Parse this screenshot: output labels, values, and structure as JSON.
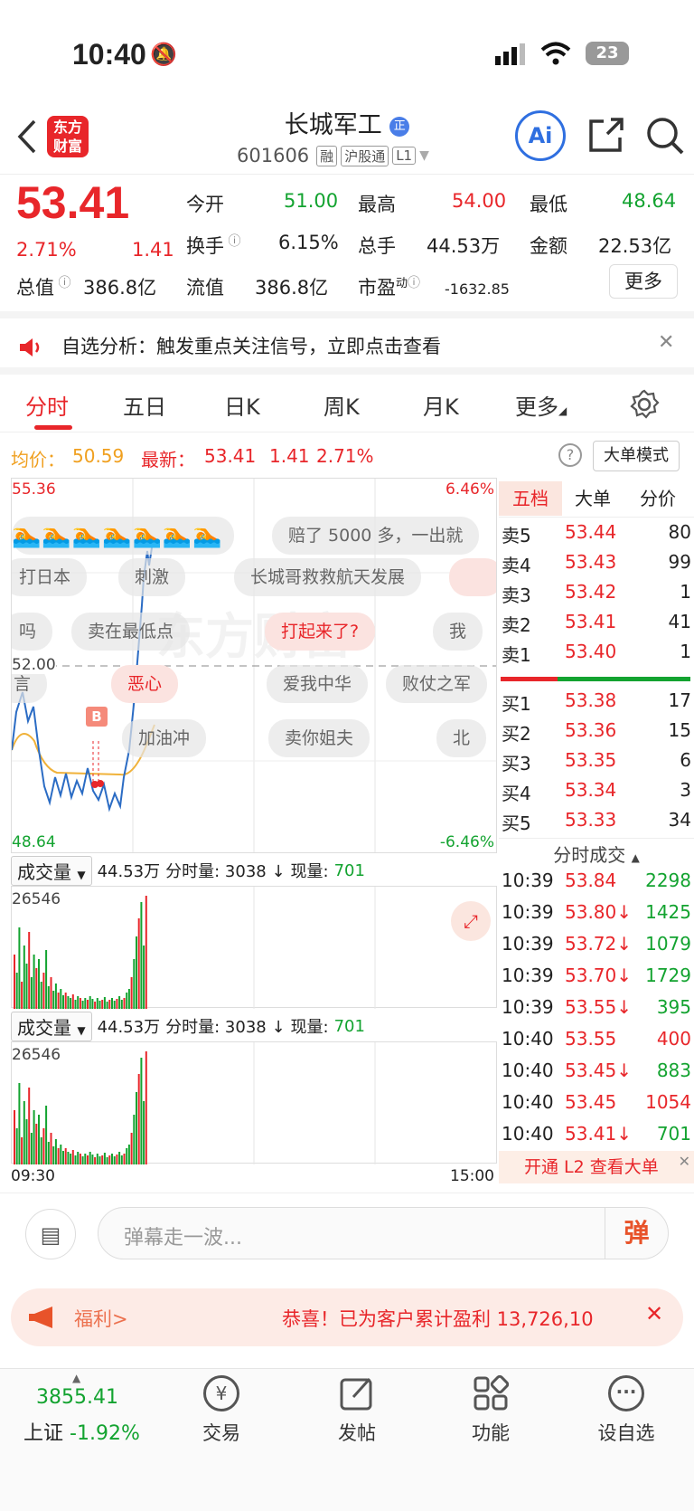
{
  "status": {
    "time": "10:40",
    "battery": "23"
  },
  "header": {
    "logo": "东方\n财富",
    "logo_l1": "东方",
    "logo_l2": "财富",
    "title": "长城军工",
    "code": "601606",
    "tags": [
      "融",
      "沪股通",
      "L1"
    ],
    "ai_label": "Ai"
  },
  "quote": {
    "price": "53.41",
    "change_pct": "2.71%",
    "change": "1.41",
    "open_label": "今开",
    "open": "51.00",
    "high_label": "最高",
    "high": "54.00",
    "low_label": "最低",
    "low": "48.64",
    "turnover_label": "换手",
    "turnover": "6.15%",
    "volume_label": "总手",
    "volume": "44.53万",
    "amount_label": "金额",
    "amount": "22.53亿",
    "mktcap_label": "总值",
    "mktcap": "386.8亿",
    "float_label": "流值",
    "float": "386.8亿",
    "pe_label": "市盈",
    "pe_sup": "动",
    "pe": "-1632.85",
    "more": "更多"
  },
  "notice": {
    "text": "自选分析：触发重点关注信号，立即点击查看"
  },
  "tabs": [
    "分时",
    "五日",
    "日K",
    "周K",
    "月K",
    "更多"
  ],
  "info": {
    "avg_label": "均价：",
    "avg": "50.59",
    "latest_label": "最新：",
    "latest": "53.41",
    "latest_chg": "1.41",
    "latest_pct": "2.71%",
    "mode": "大单模式"
  },
  "chart": {
    "ymax": "55.36",
    "ymin": "48.64",
    "pct_max": "6.46%",
    "pct_min": "-6.46%",
    "mid_label": "52.00",
    "b_marker": "B",
    "danmu": [
      "赔了 5000 多，一出就",
      "打日本",
      "刺激",
      "长城哥救救航天发展",
      "吗",
      "卖在最低点",
      "打起来了?",
      "我",
      "言",
      "恶心",
      "爱我中华",
      "败仗之军",
      "加油冲",
      "卖你姐夫",
      "北"
    ],
    "watermark": "东方财富"
  },
  "volume": {
    "selector": "成交量",
    "total": "44.53万",
    "period_label": "分时量: 3038 ↓",
    "now_label": "现量:",
    "now": "701",
    "max": "26546",
    "time_start": "09:30",
    "time_end": "15:00"
  },
  "orderbook": {
    "tabs": [
      "五档",
      "大单",
      "分价"
    ],
    "asks": [
      {
        "label": "卖5",
        "price": "53.44",
        "vol": "80"
      },
      {
        "label": "卖4",
        "price": "53.43",
        "vol": "99"
      },
      {
        "label": "卖3",
        "price": "53.42",
        "vol": "1"
      },
      {
        "label": "卖2",
        "price": "53.41",
        "vol": "41"
      },
      {
        "label": "卖1",
        "price": "53.40",
        "vol": "1"
      }
    ],
    "bids": [
      {
        "label": "买1",
        "price": "53.38",
        "vol": "17"
      },
      {
        "label": "买2",
        "price": "53.36",
        "vol": "15"
      },
      {
        "label": "买3",
        "price": "53.35",
        "vol": "6"
      },
      {
        "label": "买4",
        "price": "53.34",
        "vol": "3"
      },
      {
        "label": "买5",
        "price": "53.33",
        "vol": "34"
      }
    ],
    "ticks_title": "分时成交",
    "ticks": [
      {
        "time": "10:39",
        "price": "53.84",
        "vol": "2298"
      },
      {
        "time": "10:39",
        "price": "53.80↓",
        "vol": "1425"
      },
      {
        "time": "10:39",
        "price": "53.72↓",
        "vol": "1079"
      },
      {
        "time": "10:39",
        "price": "53.70↓",
        "vol": "1729"
      },
      {
        "time": "10:39",
        "price": "53.55↓",
        "vol": "395"
      },
      {
        "time": "10:40",
        "price": "53.55",
        "vol": "400"
      },
      {
        "time": "10:40",
        "price": "53.45↓",
        "vol": "883"
      },
      {
        "time": "10:40",
        "price": "53.45",
        "vol": "1054"
      },
      {
        "time": "10:40",
        "price": "53.41↓",
        "vol": "701"
      }
    ],
    "l2": "开通 L2 查看大单"
  },
  "input": {
    "placeholder": "弹幕走一波...",
    "send": "弹"
  },
  "welfare": {
    "label": "福利>",
    "text": "恭喜！已为客户累计盈利 13,726,10"
  },
  "tabbar": {
    "index_value": "3855.41",
    "index_name": "上证",
    "index_pct": "-1.92%",
    "items": [
      "交易",
      "发帖",
      "功能",
      "设自选"
    ]
  },
  "colors": {
    "up": "#e8262a",
    "down": "#13a330",
    "avg_line": "#f0b23a",
    "price_line": "#2b6cc4"
  }
}
